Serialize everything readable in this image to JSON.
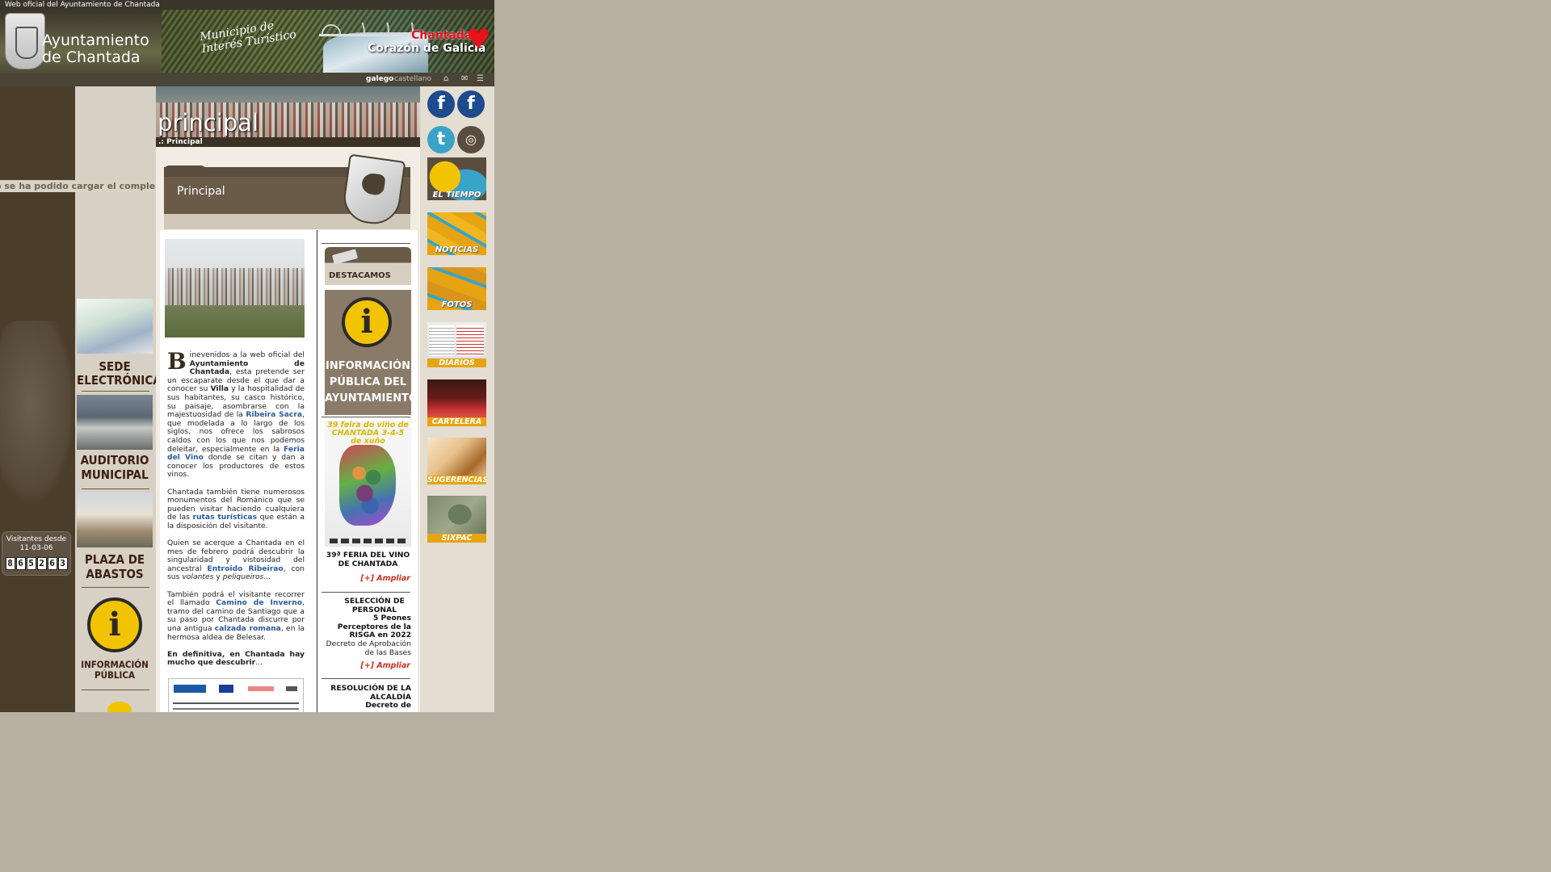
{
  "banner": {
    "top_line": "Web oficial del Ayuntamiento de Chantada",
    "org_line1": "Ayuntamiento",
    "org_line2": "de Chantada",
    "slogan_line1": "Municipio de",
    "slogan_line2": "Interés Turístico",
    "brand_line1": "Chantada,",
    "brand_line2": "Corazón de Galicia",
    "lang_gal": "galego",
    "lang_cas": "castellano",
    "icons": [
      "home-icon",
      "mail-icon",
      "sitemap-icon"
    ]
  },
  "flash_message": "o se ha podido cargar el complemento",
  "sidebar": {
    "items": [
      {
        "label": "SEDE ELECTRÓNICA",
        "icon": "laptop-photo"
      },
      {
        "label": "AUDITORIO MUNICIPAL",
        "icon": "auditorium-photo"
      },
      {
        "label": "PLAZA DE ABASTOS",
        "icon": "market-photo"
      },
      {
        "label": "INFORMACIÓN PÚBLICA",
        "icon": "info-icon"
      }
    ]
  },
  "visitors": {
    "label": "Visitantes desde",
    "since": "11-03-06",
    "digits": [
      "8",
      "6",
      "5",
      "2",
      "6",
      "3"
    ]
  },
  "page": {
    "title": "principal",
    "breadcrumb": ".: Principal",
    "section_title": "Principal"
  },
  "intro": {
    "drop_cap": "B",
    "p1_a": "inevenidos a la web oficial del ",
    "p1_b": "Ayuntamiento de Chantada",
    "p1_c": ", esta pretende ser un escaparate desde el que dar a conocer su ",
    "p1_d": "Villa",
    "p1_e": " y la hospitalidad de sus habitantes, su casco histórico, su paisaje, asombrarse con la majestuosidad de la ",
    "p1_f": "Ribeira Sacra",
    "p1_g": ", que modelada a lo largo de los siglos, nos ofrece los sabrosos caldos con los que nos podemos deleitar, especialmente en la ",
    "p1_h": "Feria del Vino",
    "p1_i": " donde se citan y dan a conocer los productores de estos vinos.",
    "p2_a": "Chantada también tiene numerosos monumentos del Románico que se pueden visitar haciendo cualquiera de las ",
    "p2_b": "rutas turísticas",
    "p2_c": " que están a la disposición del visitante.",
    "p3_a": "Quien se acerque a Chantada en el mes de febrero podrá descubrir la singularidad y vistosidad del ancestral ",
    "p3_b": "Entroido Ribeirao",
    "p3_c": ", con sus ",
    "p3_d": "volantes",
    "p3_e": " y ",
    "p3_f": "peliqueiros",
    "p3_g": "...",
    "p4_a": "También podrá el visitante recorrer el llamado ",
    "p4_b": "Camino de Inverno",
    "p4_c": ", tramo del camino de Santiago que a su paso por Chantada discurre por una antigua ",
    "p4_d": "calzada romana",
    "p4_e": ", en la hermosa aldea de Belesar.",
    "p5": "En definitiva, en Chantada hay mucho que descubrir",
    "p5_end": "..."
  },
  "destacamos": {
    "label": "DESTACAMOS",
    "info_line1": "INFORMACIÓN",
    "info_line2": "PÚBLICA DEL",
    "info_line3": "AYUNTAMIENTO",
    "poster_title": "39 feira do viño de CHANTADA 3-4-5 de xuño",
    "news": [
      {
        "title_line1": "39ª FERIA DEL VINO",
        "title_line2": "DE CHANTADA",
        "more": "[+] Ampliar"
      },
      {
        "title_line1": "SELECCIÓN DE",
        "title_line2": "PERSONAL",
        "title_line3": "5 Peones",
        "title_line4": "Perceptores de la",
        "title_line5": "RISGA en 2022",
        "body_line1": "Decreto de Aprobación",
        "body_line2": "de las Bases",
        "more": "[+] Ampliar"
      },
      {
        "title_line1": "RESOLUCIÓN DE LA",
        "title_line2": "ALCALDÍA",
        "title_line3": "Decreto de"
      }
    ]
  },
  "right_icons": {
    "social": [
      "f",
      "f",
      "t",
      "◎"
    ],
    "tiles": [
      "EL TIEMPO",
      "NOTICIAS",
      "FOTOS",
      "DIARIOS",
      "CARTELERA",
      "SUGERENCIAS",
      "SIXPAC"
    ]
  }
}
